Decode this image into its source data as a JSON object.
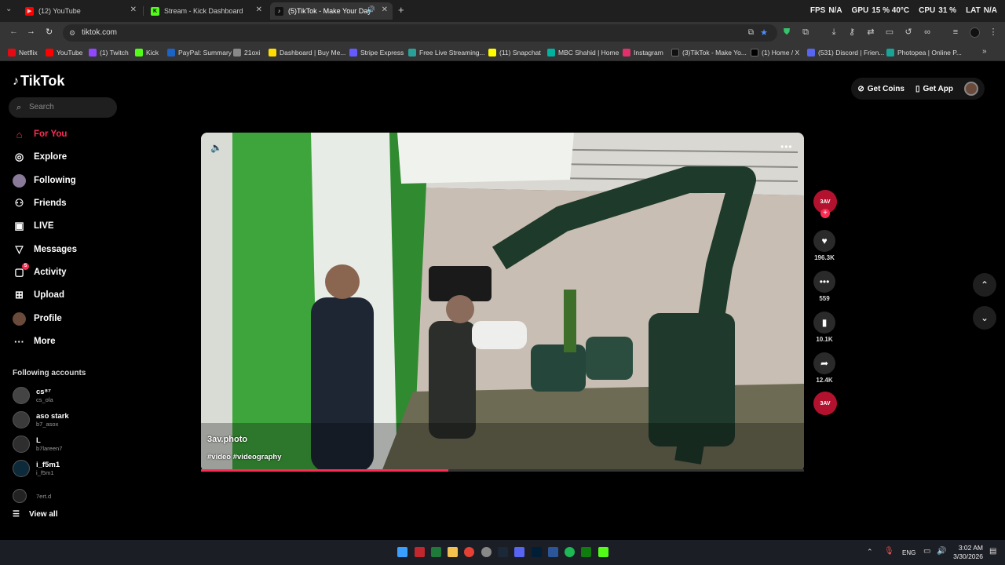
{
  "browser": {
    "tabs": [
      {
        "title": "(12) YouTube",
        "color": "#ff0000"
      },
      {
        "title": "Stream - Kick Dashboard",
        "color": "#53fc18"
      },
      {
        "title": "(5)TikTok - Make Your Day",
        "color": "#111111"
      }
    ],
    "stats": {
      "fps_label": "FPS",
      "fps": "N/A",
      "gpu_label": "GPU",
      "gpu": "15 % 40°C",
      "cpu_label": "CPU",
      "cpu": "31 %",
      "lat_label": "LAT",
      "lat": "N/A"
    },
    "url": "tiktok.com",
    "bookmarks": [
      {
        "label": "Netflix",
        "color": "#e50914"
      },
      {
        "label": "YouTube",
        "color": "#ff0000"
      },
      {
        "label": "(1) Twitch",
        "color": "#9146ff"
      },
      {
        "label": "Kick",
        "color": "#53fc18"
      },
      {
        "label": "PayPal: Summary",
        "color": "#1b63c6"
      },
      {
        "label": "21oxi",
        "color": "#888888"
      },
      {
        "label": "Dashboard | Buy Me...",
        "color": "#ffdd00"
      },
      {
        "label": "Stripe Express",
        "color": "#635bff"
      },
      {
        "label": "Free Live Streaming...",
        "color": "#2aa198"
      },
      {
        "label": "(11) Snapchat",
        "color": "#fffc00"
      },
      {
        "label": "MBC Shahid | Home",
        "color": "#00b3a1"
      },
      {
        "label": "Instagram",
        "color": "#e1306c"
      },
      {
        "label": "(3)TikTok - Make Yo...",
        "color": "#111111"
      },
      {
        "label": "(1) Home / X",
        "color": "#000000"
      },
      {
        "label": "(531) Discord | Frien...",
        "color": "#5865f2"
      },
      {
        "label": "Photopea | Online P...",
        "color": "#18a497"
      }
    ]
  },
  "tiktok": {
    "logo": "TikTok",
    "search_placeholder": "Search",
    "nav": [
      {
        "label": "For You",
        "icon": "home-icon",
        "glyph": "⌂"
      },
      {
        "label": "Explore",
        "icon": "compass-icon",
        "glyph": "◎"
      },
      {
        "label": "Following",
        "icon": "following-avatar",
        "glyph": "●"
      },
      {
        "label": "Friends",
        "icon": "friends-icon",
        "glyph": "👥"
      },
      {
        "label": "LIVE",
        "icon": "live-icon",
        "glyph": "▣"
      },
      {
        "label": "Messages",
        "icon": "messages-icon",
        "glyph": "▽"
      },
      {
        "label": "Activity",
        "icon": "activity-icon",
        "glyph": "▢",
        "badge": "5"
      },
      {
        "label": "Upload",
        "icon": "upload-icon",
        "glyph": "⊞"
      },
      {
        "label": "Profile",
        "icon": "profile-avatar",
        "glyph": "●"
      },
      {
        "label": "More",
        "icon": "more-icon",
        "glyph": "···"
      }
    ],
    "following_title": "Following accounts",
    "accounts": [
      {
        "name": "cs⁸⁷",
        "user": "cs_ola"
      },
      {
        "name": "aso stark",
        "user": "b7_asox"
      },
      {
        "name": "L",
        "user": "b7lareen7"
      },
      {
        "name": "i_f5m1",
        "user": "i_f5m1"
      },
      {
        "name": "",
        "user": "7ert.d"
      }
    ],
    "view_all": "View all",
    "get_coins": "Get Coins",
    "get_app": "Get App",
    "video": {
      "author": "3av.photo",
      "tags": "#video #videography",
      "progress": 0.41,
      "actions": {
        "likes": "196.3K",
        "comments": "559",
        "saves": "10.1K",
        "shares": "12.4K"
      },
      "profile_badge": "3AV"
    }
  },
  "taskbar": {
    "lang": "ENG",
    "time": "3:02 AM",
    "date": "3/30/2026"
  },
  "colors": {
    "accent": "#fe2c55"
  }
}
